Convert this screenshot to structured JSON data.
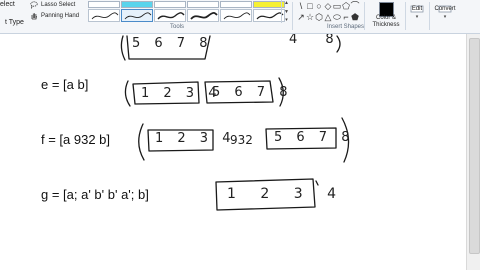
{
  "ribbon": {
    "tools": {
      "select_label": "elect",
      "type_label": "t Type",
      "lasso_label": "Lasso Select",
      "panning_label": "Panning Hand",
      "group_label": "Tools"
    },
    "pens": {
      "swatch_colors": [
        "#ffffff",
        "#59d4ec",
        "#ffffff",
        "#ffffff",
        "#ffffff",
        "#f5f033"
      ],
      "selected_index": 1
    },
    "shapes": {
      "group_label": "Insert Shapes",
      "glyphs": [
        "\\",
        "□",
        "○",
        "◇",
        "▭",
        "⬠",
        "⌒",
        "↗",
        "☆",
        "⬡",
        "△",
        "⬭",
        "⌐",
        "⬟"
      ]
    },
    "color": {
      "label_line1": "Color &",
      "label_line2": "Thickness",
      "ink_color": "#000000"
    },
    "edit": {
      "label": "Edit",
      "caret": "▾"
    },
    "convert": {
      "label": "Convert",
      "caret": "▾"
    }
  },
  "canvas": {
    "lines": [
      {
        "text": "e = [a b]"
      },
      {
        "text": "f = [a 932 b]"
      },
      {
        "text": "g = [a; a' b' b' a'; b]"
      }
    ],
    "ink": {
      "top_left": "5 6 7 8",
      "top_right": "4 8",
      "e_left": "1 2 3 4",
      "e_right": "5 6 7 8",
      "f_left": "1 2 3 4",
      "f_mid": "932",
      "f_right": "5 6 7 8",
      "g_box": "1 2 3 4"
    }
  }
}
